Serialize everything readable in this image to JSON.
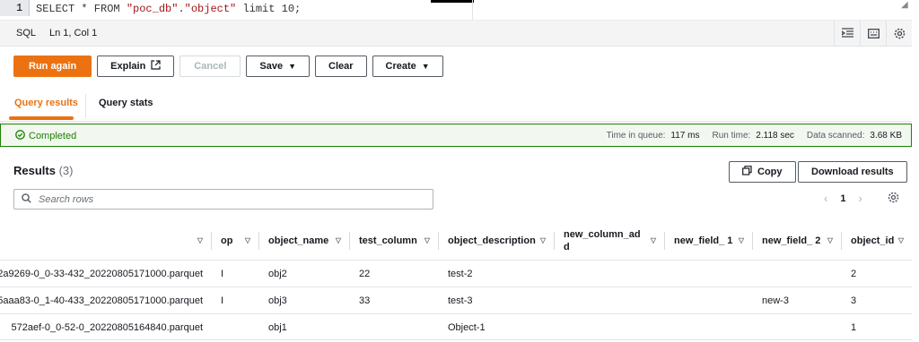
{
  "editor": {
    "line_number": "1",
    "sql_kw": "SELECT * FROM ",
    "sql_db": "\"poc_db\"",
    "sql_dot": ".",
    "sql_table": "\"object\"",
    "sql_tail": " limit 10;"
  },
  "statusbar": {
    "language": "SQL",
    "position": "Ln 1, Col 1",
    "icons": [
      "indent-icon",
      "keyboard-icon",
      "settings-icon"
    ]
  },
  "toolbar": {
    "run_again": "Run again",
    "explain": "Explain",
    "cancel": "Cancel",
    "save": "Save",
    "clear": "Clear",
    "create": "Create"
  },
  "tabs": {
    "query_results": "Query results",
    "query_stats": "Query stats"
  },
  "status": {
    "state": "Completed",
    "time_in_queue_label": "Time in queue:",
    "time_in_queue": "117 ms",
    "run_time_label": "Run time:",
    "run_time": "2.118 sec",
    "data_scanned_label": "Data scanned:",
    "data_scanned": "3.68 KB",
    "accent": "#1d8102"
  },
  "results": {
    "title": "Results",
    "count": "(3)",
    "copy": "Copy",
    "download": "Download results",
    "search_placeholder": "Search rows",
    "page": "1"
  },
  "table": {
    "headers": [
      "",
      "op",
      "object_name",
      "test_column",
      "object_description",
      "new_column_ad d",
      "new_field_ 1",
      "new_field_ 2",
      "object_id"
    ],
    "rows": [
      [
        "2a9269-0_0-33-432_20220805171000.parquet",
        "I",
        "obj2",
        "22",
        "test-2",
        "",
        "",
        "",
        "2"
      ],
      [
        "5aaa83-0_1-40-433_20220805171000.parquet",
        "I",
        "obj3",
        "33",
        "test-3",
        "",
        "",
        "new-3",
        "3"
      ],
      [
        "572aef-0_0-52-0_20220805164840.parquet",
        "",
        "obj1",
        "",
        "Object-1",
        "",
        "",
        "",
        "1"
      ]
    ]
  },
  "colors": {
    "primary": "#ec7211",
    "success": "#1d8102"
  }
}
